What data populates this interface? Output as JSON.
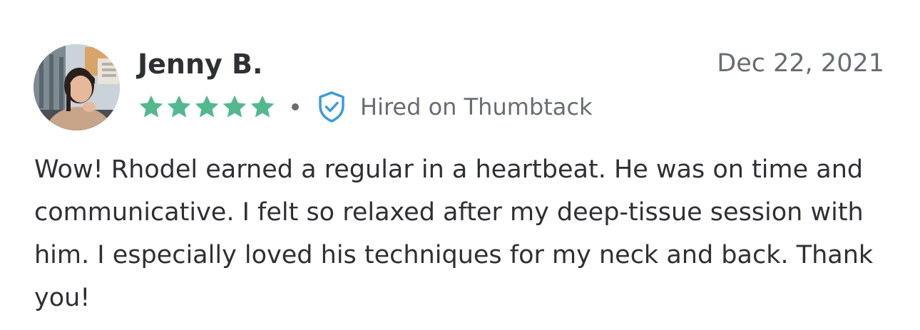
{
  "review": {
    "reviewer_name": "Jenny B.",
    "date": "Dec 22, 2021",
    "rating": 5,
    "rating_max": 5,
    "hired_label": "Hired on Thumbtack",
    "text": "Wow! Rhodel earned a regular in a heartbeat. He was on time and communicative. I felt so relaxed after my deep-tissue session with him. I especially loved his techniques for my neck and back. Thank you!"
  },
  "icons": {
    "stars": "star-icon",
    "separator": "dot-separator",
    "verified": "shield-check-icon"
  },
  "colors": {
    "star": "#54b88f",
    "shield": "#3d9bdc",
    "name_text": "#2f3033",
    "secondary_text": "#676d73"
  }
}
